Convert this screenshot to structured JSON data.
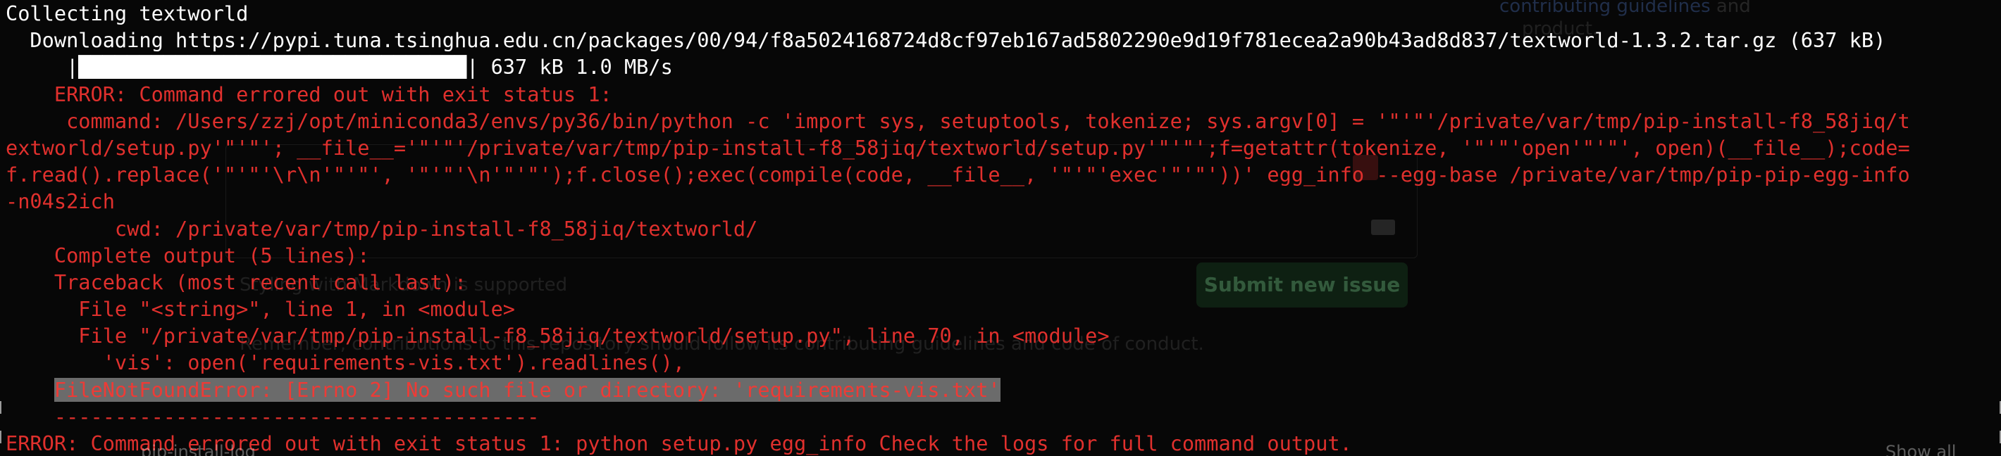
{
  "terminal": {
    "lines": [
      {
        "text": "Collecting textworld",
        "color": "white"
      },
      {
        "text": "  Downloading https://pypi.tuna.tsinghua.edu.cn/packages/00/94/f8a5024168724d8cf97eb167ad5802290e9d19f781ecea2a90b43ad8d837/textworld-1.3.2.tar.gz (637 kB)",
        "color": "white"
      },
      {
        "text": "     |████████████████████████████████| 637 kB 1.0 MB/s",
        "color": "white"
      },
      {
        "text": "    ERROR: Command errored out with exit status 1:",
        "color": "red"
      },
      {
        "text": "     command: /Users/zzj/opt/miniconda3/envs/py36/bin/python -c 'import sys, setuptools, tokenize; sys.argv[0] = '\"'\"'/private/var/tmp/pip-install-f8_58jiq/t",
        "color": "red"
      },
      {
        "text": "extworld/setup.py'\"'\"'; __file__='\"'\"'/private/var/tmp/pip-install-f8_58jiq/textworld/setup.py'\"'\"';f=getattr(tokenize, '\"'\"'open'\"'\"', open)(__file__);code=",
        "color": "red"
      },
      {
        "text": "f.read().replace('\"'\"'\\r\\n'\"'\"', '\"'\"'\\n'\"'\"');f.close();exec(compile(code, __file__, '\"'\"'exec'\"'\"'))' egg_info --egg-base /private/var/tmp/pip-pip-egg-info",
        "color": "red"
      },
      {
        "text": "-n04s2ich",
        "color": "red"
      },
      {
        "text": "         cwd: /private/var/tmp/pip-install-f8_58jiq/textworld/",
        "color": "red"
      },
      {
        "text": "    Complete output (5 lines):",
        "color": "red"
      },
      {
        "text": "    Traceback (most recent call last):",
        "color": "red"
      },
      {
        "text": "      File \"<string>\", line 1, in <module>",
        "color": "red"
      },
      {
        "text": "      File \"/private/var/tmp/pip-install-f8_58jiq/textworld/setup.py\", line 70, in <module>",
        "color": "red"
      },
      {
        "text": "        'vis': open('requirements-vis.txt').readlines(),",
        "color": "red"
      },
      {
        "text": "    FileNotFoundError: [Errno 2] No such file or directory: 'requirements-vis.txt'",
        "color": "red"
      },
      {
        "text": "    ----------------------------------------",
        "color": "red"
      },
      {
        "text": "ERROR: Command errored out with exit status 1: python setup.py egg_info Check the logs for full command output.",
        "color": "red"
      }
    ],
    "error_line_indent": "    ",
    "error_line_selected": "FileNotFoundError: [Errno 2] No such file or directory: 'requirements-vis.txt'"
  },
  "background_page": {
    "contributing_link": "contributing guidelines",
    "contributing_and": "and",
    "product": "product.",
    "markdown_supported": "Styling with Markdown is supported",
    "submit_button": "Submit new issue",
    "contribution_notice": "Remember, contributions to this repository should follow its contributing guidelines and code of conduct.",
    "bottom_file": "pip-install-log",
    "bottom_link": "Show all"
  },
  "colors": {
    "background": "#070707",
    "text_white": "#ffffff",
    "text_red": "#e0302d",
    "selection": "#6b6b6b"
  }
}
